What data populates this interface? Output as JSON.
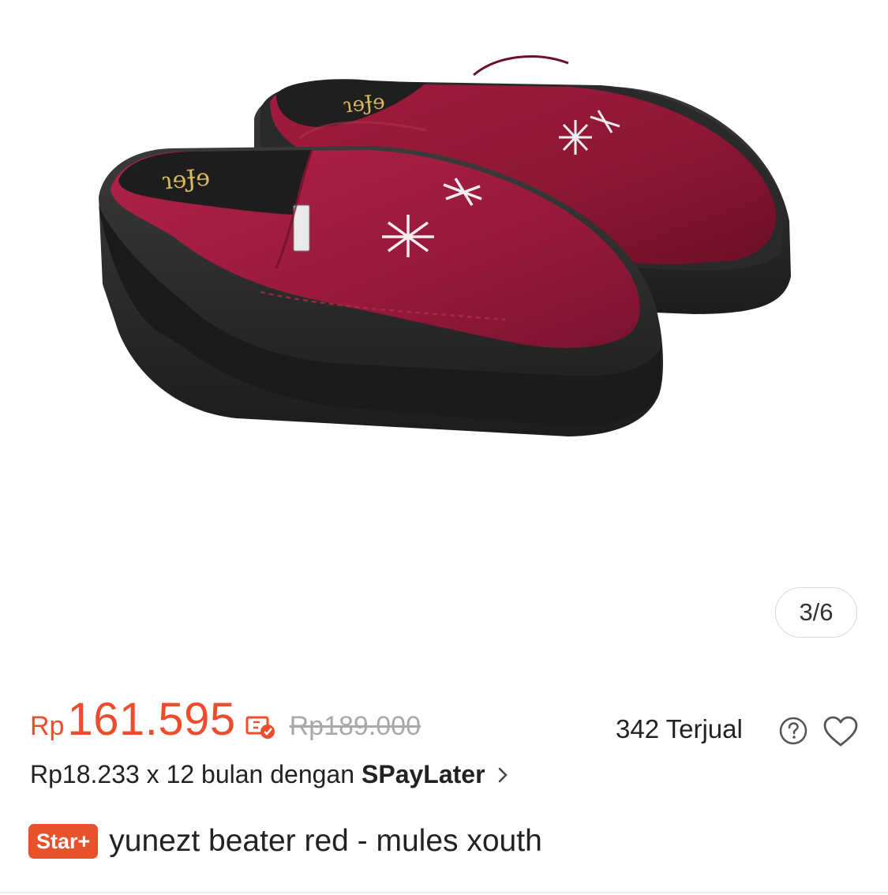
{
  "gallery": {
    "counter": "3/6",
    "image_alt": "product-photo-red-suede-mules"
  },
  "price": {
    "currency": "Rp",
    "amount": "161.595",
    "original": "Rp189.000",
    "voucher_icon": "voucher-check-icon",
    "color": "#ee4d2d"
  },
  "sales": {
    "sold_text": "342 Terjual"
  },
  "installment": {
    "text": "Rp18.233 x 12 bulan dengan",
    "provider": "SPayLater"
  },
  "product": {
    "badge": "Star+",
    "badge_color": "#e8512a",
    "title": "yunezt beater red - mules xouth"
  }
}
